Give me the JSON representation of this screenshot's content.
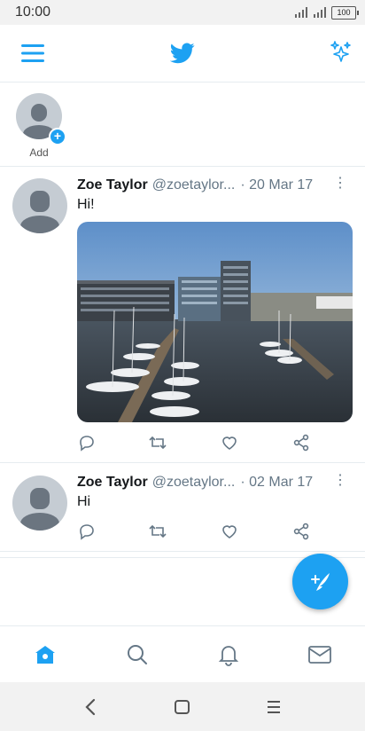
{
  "status_bar": {
    "time": "10:00",
    "battery": "100"
  },
  "top_bar": {
    "menu_icon": "hamburger-menu-icon",
    "logo_icon": "twitter-bird-icon",
    "sparkle_icon": "sparkle-icon"
  },
  "fleets": {
    "add_label": "Add"
  },
  "tweets": [
    {
      "name": "Zoe Taylor",
      "handle": "@zoetaylor...",
      "date": "· 20 Mar 17",
      "text": "Hi!",
      "has_media": true
    },
    {
      "name": "Zoe Taylor",
      "handle": "@zoetaylor...",
      "date": "· 02 Mar 17",
      "text": "Hi",
      "has_media": false
    }
  ],
  "bottom_nav": [
    "home-icon",
    "search-icon",
    "notifications-icon",
    "messages-icon"
  ],
  "colors": {
    "accent": "#1da1f2",
    "text": "#14171a",
    "muted": "#657786",
    "divider": "#e6ecf0"
  }
}
